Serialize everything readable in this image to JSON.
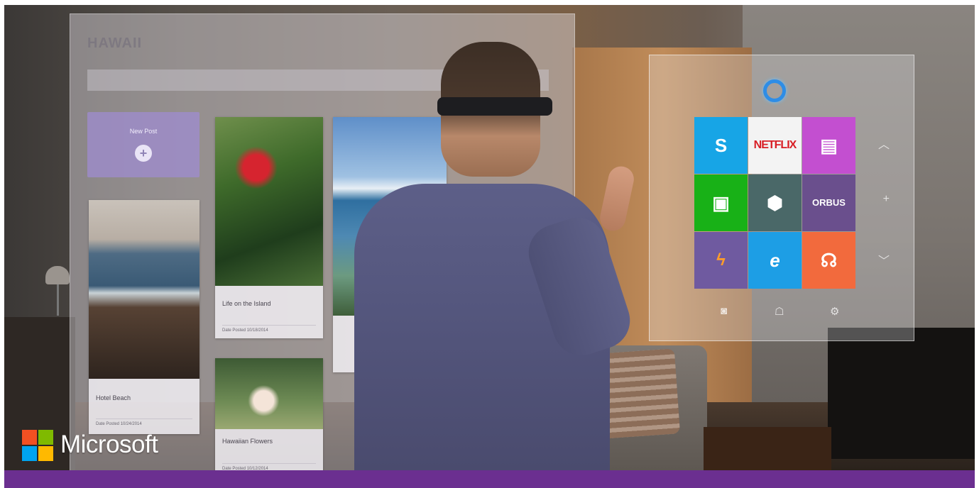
{
  "brand": {
    "name": "Microsoft",
    "colors": {
      "red": "#f25022",
      "green": "#7fba00",
      "blue": "#00a4ef",
      "yellow": "#ffb900",
      "bar": "#6b2f90"
    }
  },
  "holo_app": {
    "title": "HAWAII",
    "new_post_label": "New Post",
    "cards": [
      {
        "title": "Hotel Beach",
        "date": "Date Posted 10/24/2014"
      },
      {
        "title": "Life on the Island",
        "date": "Date Posted 10/18/2014"
      },
      {
        "title": "Hawaiian Flowers",
        "date": "Date Posted 10/12/2014"
      }
    ]
  },
  "start_menu": {
    "tiles": [
      {
        "name": "skype",
        "label": "S",
        "icon": "skype-icon"
      },
      {
        "name": "netflix",
        "label": "NETFLIX",
        "icon": "netflix-logo"
      },
      {
        "name": "app",
        "label": "",
        "icon": "app-icon"
      },
      {
        "name": "store",
        "label": "",
        "icon": "store-icon"
      },
      {
        "name": "game",
        "label": "",
        "icon": "game-icon"
      },
      {
        "name": "orbus",
        "label": "ORBUS",
        "icon": "orbus-icon"
      },
      {
        "name": "onelight",
        "label": "",
        "icon": "onelight-icon"
      },
      {
        "name": "internet-explorer",
        "label": "e",
        "icon": "ie-icon"
      },
      {
        "name": "music",
        "label": "",
        "icon": "headphones-icon"
      }
    ]
  }
}
